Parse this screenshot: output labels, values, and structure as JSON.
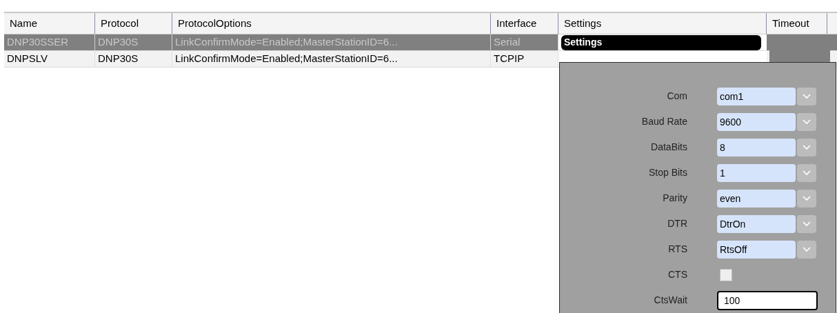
{
  "table": {
    "columns": [
      "Name",
      "Protocol",
      "ProtocolOptions",
      "Interface",
      "Settings",
      "Timeout"
    ],
    "rows": [
      {
        "selected": true,
        "cells": [
          "DNP30SSER",
          "DNP30S",
          "LinkConfirmMode=Enabled;MasterStationID=6...",
          "Serial"
        ],
        "settings_button": "Settings"
      },
      {
        "selected": false,
        "cells": [
          "DNPSLV",
          "DNP30S",
          "LinkConfirmMode=Enabled;MasterStationID=6...",
          "TCPIP"
        ]
      }
    ]
  },
  "settings_popup": {
    "fields": [
      {
        "kind": "select",
        "label": "Com",
        "value": "com1"
      },
      {
        "kind": "select",
        "label": "Baud Rate",
        "value": "9600"
      },
      {
        "kind": "select",
        "label": "DataBits",
        "value": "8"
      },
      {
        "kind": "select",
        "label": "Stop Bits",
        "value": "1"
      },
      {
        "kind": "select",
        "label": "Parity",
        "value": "even"
      },
      {
        "kind": "select",
        "label": "DTR",
        "value": "DtrOn"
      },
      {
        "kind": "select",
        "label": "RTS",
        "value": "RtsOff"
      },
      {
        "kind": "checkbox",
        "label": "CTS",
        "checked": false
      },
      {
        "kind": "text",
        "label": "CtsWait",
        "value": "100"
      }
    ]
  }
}
